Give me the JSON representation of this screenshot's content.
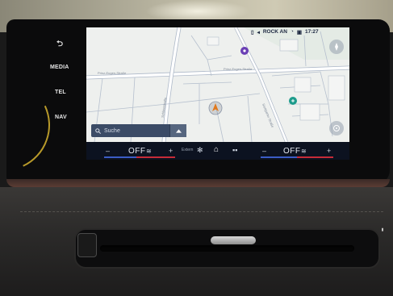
{
  "hardkeys": {
    "back_symbol": "⮌",
    "media": "MEDIA",
    "tel": "TEL",
    "nav": "NAV"
  },
  "statusbar": {
    "source": "ROCK AN",
    "time": "17:27"
  },
  "map": {
    "street_1": "Prinz-Eugen-Straße",
    "street_2": "Prinz-Eugen-Straße",
    "street_3": "Schlossstraße",
    "street_4": "Stuttgarter Straße"
  },
  "search": {
    "placeholder": "Suche"
  },
  "climate": {
    "left_value": "OFF",
    "right_value": "OFF",
    "plus": "+",
    "minus": "–",
    "center_label": "Extern"
  },
  "colors": {
    "screen_bg": "#eef0ee",
    "road": "#ffffff",
    "road_outline": "#aeb9c9",
    "water_green": "#dfe9e1",
    "poi_purple": "#6a3fb5",
    "poi_teal": "#1e9c8c",
    "position_orange": "#e07a1f",
    "bar_red": "#c62b38",
    "bar_blue": "#3b5cc6"
  }
}
